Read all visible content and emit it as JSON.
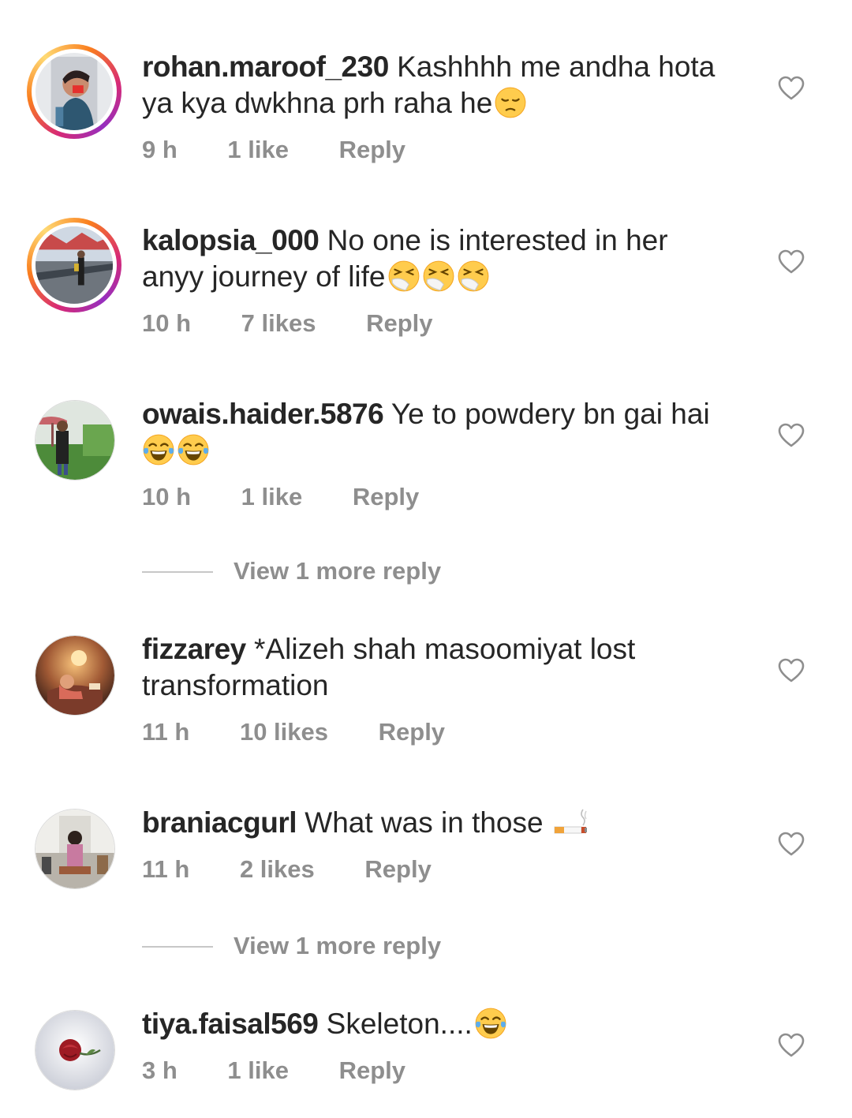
{
  "comments": [
    {
      "username": "rohan.maroof_230",
      "text_line1": "Kashhhh me andha hota",
      "text_line2": "ya kya dwkhna prh raha he",
      "time": "9 h",
      "likes": "1 like",
      "reply_label": "Reply",
      "emoji": [
        "pensive-face"
      ]
    },
    {
      "username": "kalopsia_000",
      "text_line1": "No one is interested in her",
      "text_line2": "anyy journey of life",
      "time": "10 h",
      "likes": "7 likes",
      "reply_label": "Reply",
      "emoji": [
        "sneezing-face",
        "sneezing-face",
        "sneezing-face"
      ]
    },
    {
      "username": "owais.haider.5876",
      "text_line1": "Ye to powdery bn gai hai",
      "text_line2": "",
      "time": "10 h",
      "likes": "1 like",
      "reply_label": "Reply",
      "emoji": [
        "tears-of-joy-face",
        "tears-of-joy-face"
      ],
      "view_more": "View 1 more reply"
    },
    {
      "username": "fizzarey",
      "text_line1": "*Alizeh shah masoomiyat lost",
      "text_line2": "transformation",
      "time": "11 h",
      "likes": "10 likes",
      "reply_label": "Reply",
      "emoji": []
    },
    {
      "username": "braniacgurl",
      "text_line1": "What was in those",
      "text_line2": "",
      "time": "11 h",
      "likes": "2 likes",
      "reply_label": "Reply",
      "emoji": [
        "cigarette"
      ],
      "view_more": "View 1 more reply"
    },
    {
      "username": "tiya.faisal569",
      "text_line1": "Skeleton....",
      "text_line2": "",
      "time": "3 h",
      "likes": "1 like",
      "reply_label": "Reply",
      "emoji": [
        "tears-of-joy-face"
      ]
    }
  ],
  "colors": {
    "text": "#262626",
    "meta": "#8e8e8e",
    "heart_outline": "#8e8e8e",
    "story_ring": [
      "#d62976",
      "#fa7e1e",
      "#feda75"
    ]
  }
}
